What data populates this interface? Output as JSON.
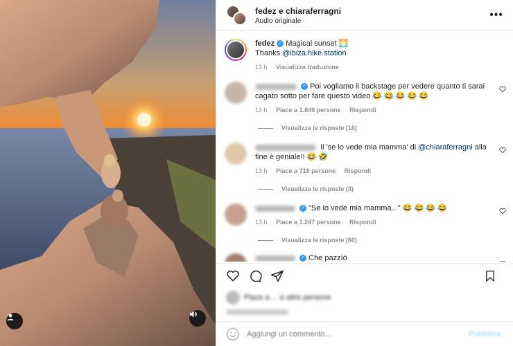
{
  "header": {
    "title": "fedez e chiaraferragni",
    "subtitle": "Audio originale",
    "more_icon": "more-horizontal-icon"
  },
  "caption": {
    "username": "fedez",
    "text": "Magical sunset",
    "emoji": "🌅",
    "thanks": "Thanks",
    "mention": "@ibiza.hike.station",
    "time": "13 h",
    "translate": "Visualizza traduzione"
  },
  "comments": [
    {
      "text": "Poi vogliamo il backstage per vedere quanto ti sarai cagato sotto per fare questo video 😂 😂 😂 😂 😂",
      "time": "13 h",
      "likes": "Piace a 1.849 persone",
      "reply": "Rispondi",
      "replies": "Visualizza le risposte (16)"
    },
    {
      "text_pre": "Il 'se lo vede mia mamma' di",
      "mention": "@chiaraferragni",
      "text_post": "alla fine è geniale!! 😂 🤣",
      "time": "13 h",
      "likes": "Piace a 718 persone",
      "reply": "Rispondi",
      "replies": "Visualizza le risposte (3)"
    },
    {
      "text": "\"Se lo vede mia mamma...\" 😂 😂 😂 😂",
      "time": "13 h",
      "likes": "Piace a 1.247 persone",
      "reply": "Rispondi",
      "replies": "Visualizza le risposte (60)"
    },
    {
      "text": "Che pazzìò"
    }
  ],
  "likes_line": "Piace a ... e altre persone",
  "add_comment": {
    "placeholder": "Aggiungi un commento...",
    "publish": "Pubblica"
  },
  "colors": {
    "link": "#00376b",
    "verified": "#3897f0",
    "muted": "#8e8e8e",
    "text": "#262626"
  }
}
